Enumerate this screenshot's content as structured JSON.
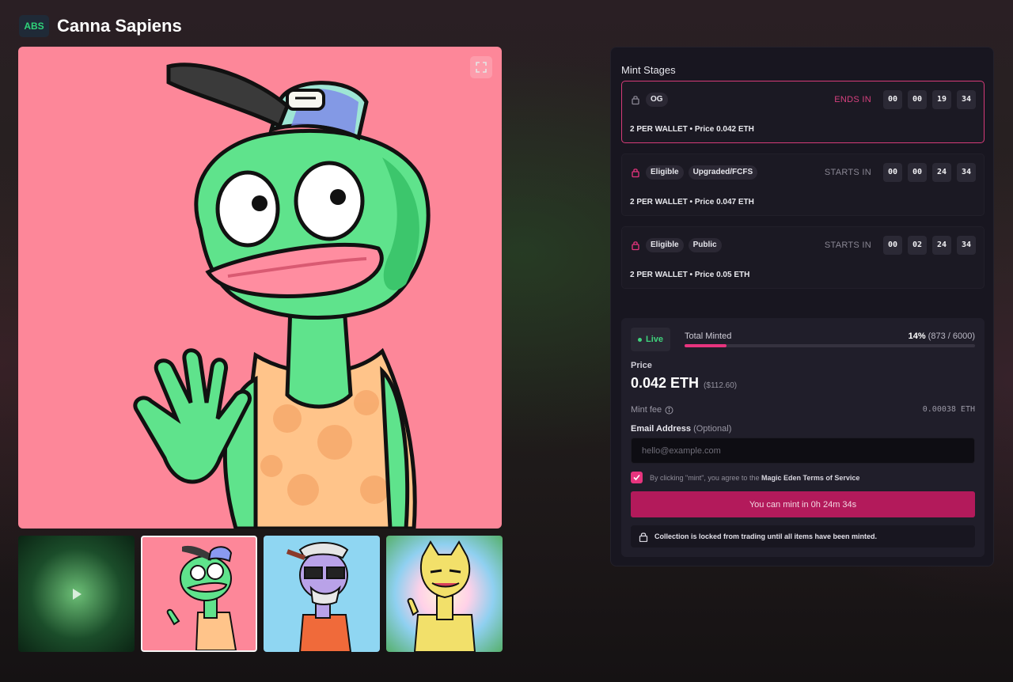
{
  "header": {
    "chain_badge": "ABS",
    "title": "Canna Sapiens"
  },
  "gallery": {
    "main_image": "canna-sapiens-green-character-artwork",
    "thumbnails": [
      {
        "name": "video-thumbnail"
      },
      {
        "name": "green-character-thumbnail"
      },
      {
        "name": "purple-character-thumbnail"
      },
      {
        "name": "yellow-character-thumbnail"
      }
    ]
  },
  "mint_panel": {
    "title": "Mint Stages",
    "stages": [
      {
        "chips": [
          "OG"
        ],
        "status": "ENDS IN",
        "timer": [
          "00",
          "00",
          "19",
          "34"
        ],
        "details": "2 PER WALLET • Price 0.042 ETH",
        "active": true
      },
      {
        "chips": [
          "Eligible",
          "Upgraded/FCFS"
        ],
        "status": "STARTS IN",
        "timer": [
          "00",
          "00",
          "24",
          "34"
        ],
        "details": "2 PER WALLET • Price 0.047 ETH",
        "active": false
      },
      {
        "chips": [
          "Eligible",
          "Public"
        ],
        "status": "STARTS IN",
        "timer": [
          "00",
          "02",
          "24",
          "34"
        ],
        "details": "2 PER WALLET • Price 0.05 ETH",
        "active": false
      }
    ],
    "live_label": "Live",
    "total_minted_label": "Total Minted",
    "minted_percent": "14%",
    "minted_counts": "(873 / 6000)",
    "minted_fraction": 0.1455,
    "price_label": "Price",
    "price_value": "0.042 ETH",
    "price_usd": "($112.60)",
    "mint_fee_label": "Mint fee",
    "mint_fee_value": "0.00038 ETH",
    "email_label": "Email Address",
    "email_optional": "(Optional)",
    "email_placeholder": "hello@example.com",
    "terms_prefix": "By clicking \"mint\", you agree to the",
    "terms_link": "Magic Eden Terms of Service",
    "mint_button": "You can mint in 0h 24m 34s",
    "lock_note": "Collection is locked from trading until all items have been minted."
  },
  "colors": {
    "accent": "#e7347e",
    "live": "#3fd37c",
    "badge_text": "#2fd37a",
    "art_bg": "#fd8799"
  }
}
